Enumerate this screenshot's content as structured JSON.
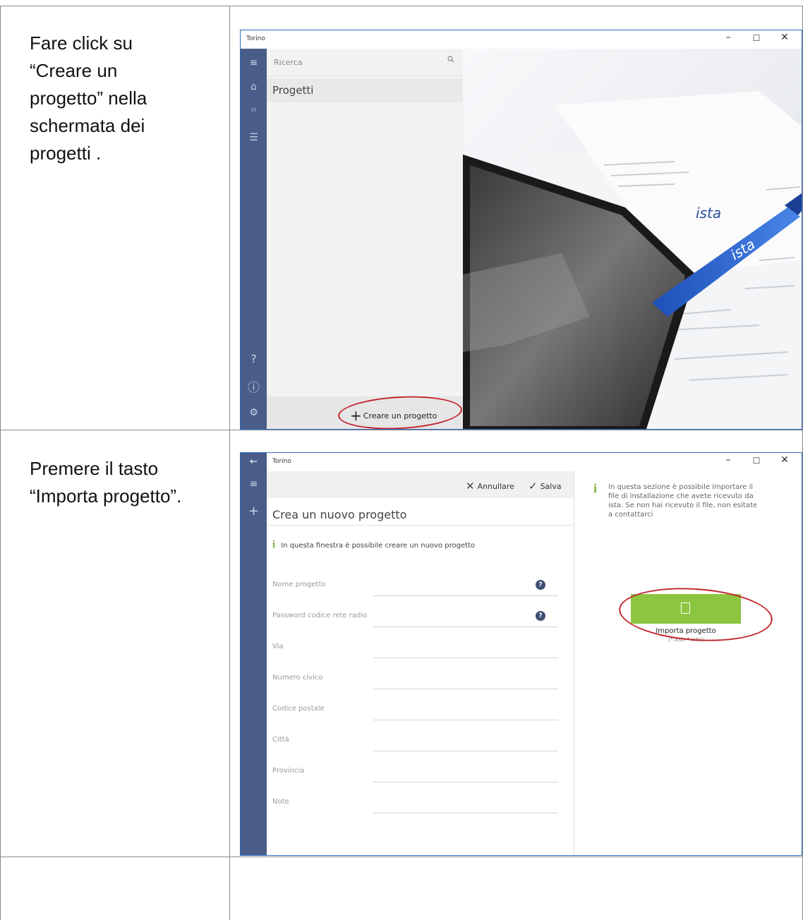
{
  "rows": [
    {
      "instruction_lines": [
        "Fare click su",
        "“Creare un",
        "progetto” nella",
        "schermata dei",
        "progetti ."
      ],
      "window": {
        "title": "Torino",
        "search_placeholder": "Ricerca",
        "nav_item": "Progetti",
        "create_button": "Creare un progetto",
        "photo_text_1": "ista",
        "photo_text_2": "ista"
      }
    },
    {
      "instruction_lines": [
        "Premere il tasto",
        "“Importa progetto”."
      ],
      "window": {
        "title": "Torino",
        "cancel_label": "Annullare",
        "save_label": "Salva",
        "heading": "Crea un nuovo progetto",
        "info_text": "In questa finestra è possibile creare un nuovo progetto",
        "fields": [
          "Nome progetto",
          "Password codice rete radio",
          "Via",
          "Numero civico",
          "Codice postale",
          "Città",
          "Provincia",
          "Note"
        ],
        "side_info": "In questa sezione è possibile importare il file di installazione che avete ricevuto da ista. Se non hai ricevuto il file, non esitate a contattarci",
        "import_label": "Importa progetto",
        "import_ext": "(*.xsti *.isto)"
      }
    }
  ],
  "colors": {
    "rail": "#4a5d89",
    "accent_green": "#8cc540",
    "highlight_red": "#c4262e",
    "window_border": "#2d6bc1"
  },
  "icons": [
    "hamburger-icon",
    "home-icon",
    "radio-tower-icon",
    "list-icon",
    "help-icon",
    "info-icon",
    "settings-icon",
    "search-icon",
    "back-arrow-icon",
    "plus-icon",
    "close-x-icon",
    "checkmark-icon",
    "document-icon"
  ]
}
